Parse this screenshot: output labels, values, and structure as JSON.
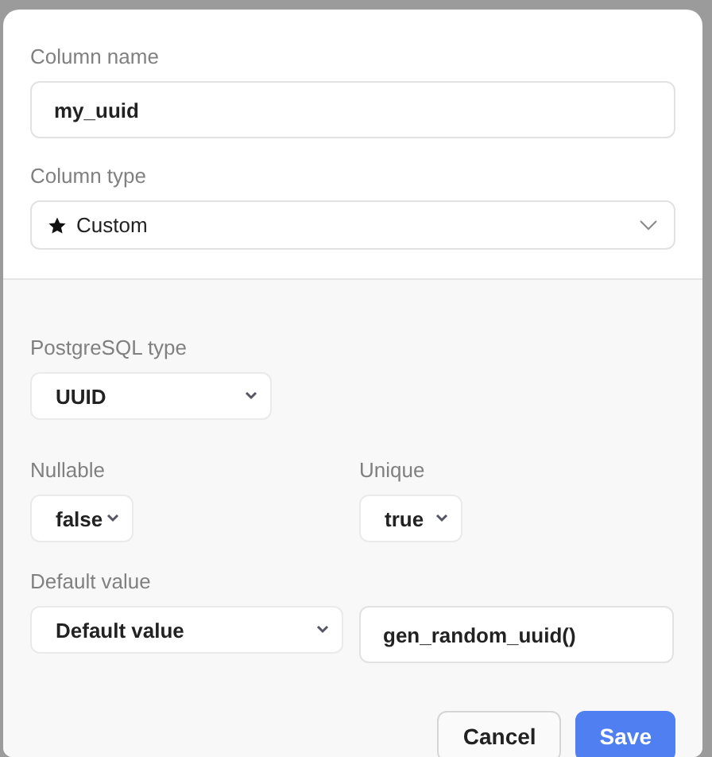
{
  "column_name": {
    "label": "Column name",
    "value": "my_uuid"
  },
  "column_type": {
    "label": "Column type",
    "value": "Custom"
  },
  "postgresql_type": {
    "label": "PostgreSQL type",
    "value": "UUID"
  },
  "nullable": {
    "label": "Nullable",
    "value": "false"
  },
  "unique": {
    "label": "Unique",
    "value": "true"
  },
  "default_value": {
    "label": "Default value",
    "mode": "Default value",
    "value": "gen_random_uuid()"
  },
  "buttons": [
    {
      "label": "Cancel",
      "kind": "secondary"
    },
    {
      "label": "Save",
      "kind": "primary"
    }
  ]
}
